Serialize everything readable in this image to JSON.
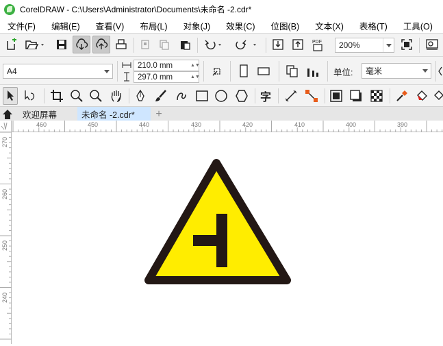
{
  "window": {
    "title": "CorelDRAW - C:\\Users\\Administrator\\Documents\\未命名 -2.cdr*"
  },
  "menu": [
    "文件(F)",
    "编辑(E)",
    "查看(V)",
    "布局(L)",
    "对象(J)",
    "效果(C)",
    "位图(B)",
    "文本(X)",
    "表格(T)",
    "工具(O)"
  ],
  "toolbar": {
    "zoom_value": "200%"
  },
  "property_bar": {
    "page_size": "A4",
    "width_value": "210.0 mm",
    "height_value": "297.0 mm",
    "units_label": "单位:",
    "units_value": "毫米"
  },
  "toolbox": {
    "text_tool_glyph": "字"
  },
  "tabs": {
    "welcome": "欢迎屏幕",
    "document": "未命名 -2.cdr*",
    "add": "+"
  },
  "ruler": {
    "h_labels": [
      "460",
      "450",
      "440",
      "430",
      "420",
      "410",
      "400",
      "390"
    ],
    "v_labels": [
      "270",
      "260",
      "250",
      "240"
    ]
  },
  "colors": {
    "sign_fill": "#ffed00",
    "sign_stroke": "#231815",
    "tab_active": "#cfe6ff"
  }
}
